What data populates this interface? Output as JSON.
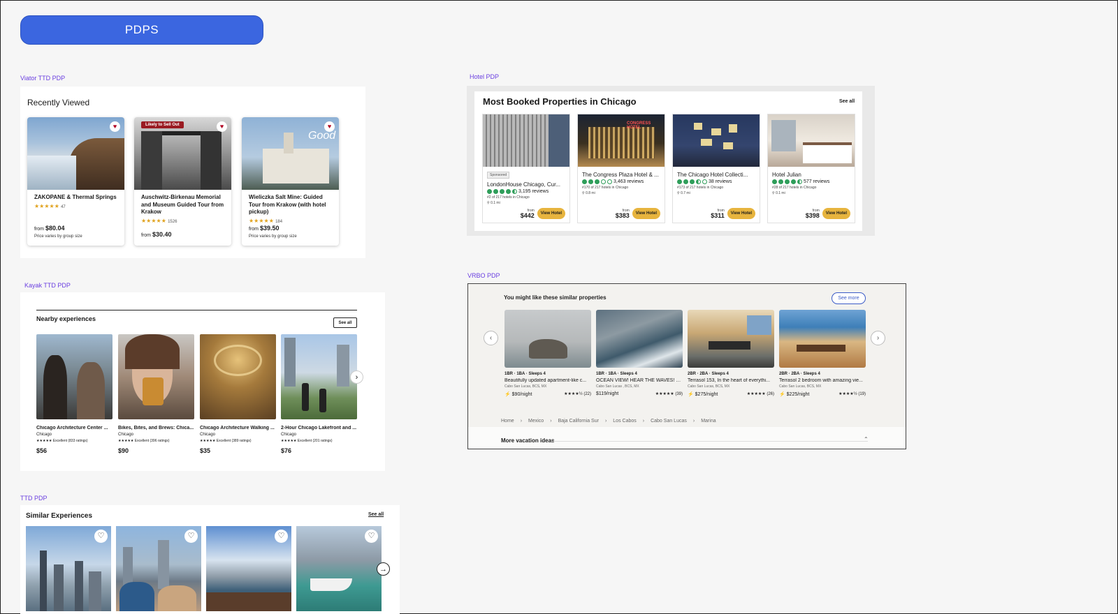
{
  "page_title": "PDPS",
  "viator": {
    "label": "Viator TTD PDP",
    "heading": "Recently Viewed",
    "cards": [
      {
        "title": "ZAKOPANE & Thermal Springs",
        "stars": "★★★★★",
        "count": "47",
        "from": "from",
        "price": "$80.04",
        "note": "Price varies by group size"
      },
      {
        "badge": "Likely to Sell Out",
        "title": "Auschwitz-Birkenau Memorial and Museum Guided Tour from Krakow",
        "stars": "★★★★★",
        "count": "1526",
        "from": "from",
        "price": "$30.40"
      },
      {
        "title": "Wieliczka Salt Mine: Guided Tour from Krakow (with hotel pickup)",
        "stars": "★★★★★",
        "count": "184",
        "from": "from",
        "price": "$39.50",
        "note": "Price varies by group size"
      }
    ]
  },
  "hotel": {
    "label": "Hotel PDP",
    "heading": "Most Booked Properties in Chicago",
    "see_all": "See all",
    "cards": [
      {
        "sponsored": "Sponsored",
        "name": "LondonHouse Chicago, Cur...",
        "reviews": "3,195 reviews",
        "rank": "#2 of 217 hotels in Chicago",
        "dist": "0.1 mi",
        "from": "from",
        "price": "$442",
        "button": "View Hotel"
      },
      {
        "name": "The Congress Plaza Hotel & ...",
        "reviews": "3,463 reviews",
        "rank": "#170 of 217 hotels in Chicago",
        "dist": "0.8 mi",
        "from": "from",
        "price": "$383",
        "button": "View Hotel"
      },
      {
        "name": "The Chicago Hotel Collecti...",
        "reviews": "38 reviews",
        "rank": "#173 of 217 hotels in Chicago",
        "dist": "0.7 mi",
        "from": "from",
        "price": "$311",
        "button": "View Hotel"
      },
      {
        "name": "Hotel Julian",
        "reviews": "577 reviews",
        "rank": "#28 of 217 hotels in Chicago",
        "dist": "0.1 mi",
        "from": "from",
        "price": "$398",
        "button": "View Hotel"
      }
    ]
  },
  "kayak": {
    "label": "Kayak TTD PDP",
    "heading": "Nearby experiences",
    "see_all": "See all",
    "cards": [
      {
        "title": "Chicago Architecture Center ...",
        "city": "Chicago",
        "rating": "★★★★★ Excellent (833 ratings)",
        "price": "$56"
      },
      {
        "title": "Bikes, Bites, and Brews: Chica...",
        "city": "Chicago",
        "rating": "★★★★★ Excellent (396 ratings)",
        "price": "$90"
      },
      {
        "title": "Chicago Architecture Walking ...",
        "city": "Chicago",
        "rating": "★★★★★ Excellent (389 ratings)",
        "price": "$35"
      },
      {
        "title": "2-Hour Chicago Lakefront and ...",
        "city": "Chicago",
        "rating": "★★★★★ Excellent (201 ratings)",
        "price": "$76"
      }
    ]
  },
  "vrbo": {
    "label": "VRBO PDP",
    "heading": "You might like these similar properties",
    "see_more": "See more",
    "cards": [
      {
        "beds": "1BR · 1BA · Sleeps 4",
        "desc": "Beautifully updated apartment-like c...",
        "loc": "Cabo San Lucas, BCS, MX",
        "price": "⚡ $90/night",
        "rating": "★★★★½ (22)"
      },
      {
        "beds": "1BR · 1BA · Sleeps 4",
        "desc": "OCEAN VIEW! HEAR THE WAVES! St...",
        "loc": "Cabo San Lucas , BCS, MX",
        "price": "$119/night",
        "rating": "★★★★★ (39)"
      },
      {
        "beds": "2BR · 2BA · Sleeps 4",
        "desc": "Terrasol 153, In the heart of everythi...",
        "loc": "Cabo San Lucas, BCS, MX",
        "price": "⚡ $275/night",
        "rating": "★★★★★ (26)"
      },
      {
        "beds": "2BR · 2BA · Sleeps 4",
        "desc": "Terrasol 2 bedroom with amazing vie...",
        "loc": "Cabo San Lucas, BCS, MX",
        "price": "⚡ $225/night",
        "rating": "★★★★½ (19)"
      }
    ],
    "breadcrumbs": [
      "Home",
      "Mexico",
      "Baja California Sur",
      "Los Cabos",
      "Cabo San Lucas",
      "Marina"
    ],
    "more": "More vacation ideas"
  },
  "ttd": {
    "label": "TTD PDP",
    "heading": "Similar Experiences",
    "see_all": "See all"
  }
}
